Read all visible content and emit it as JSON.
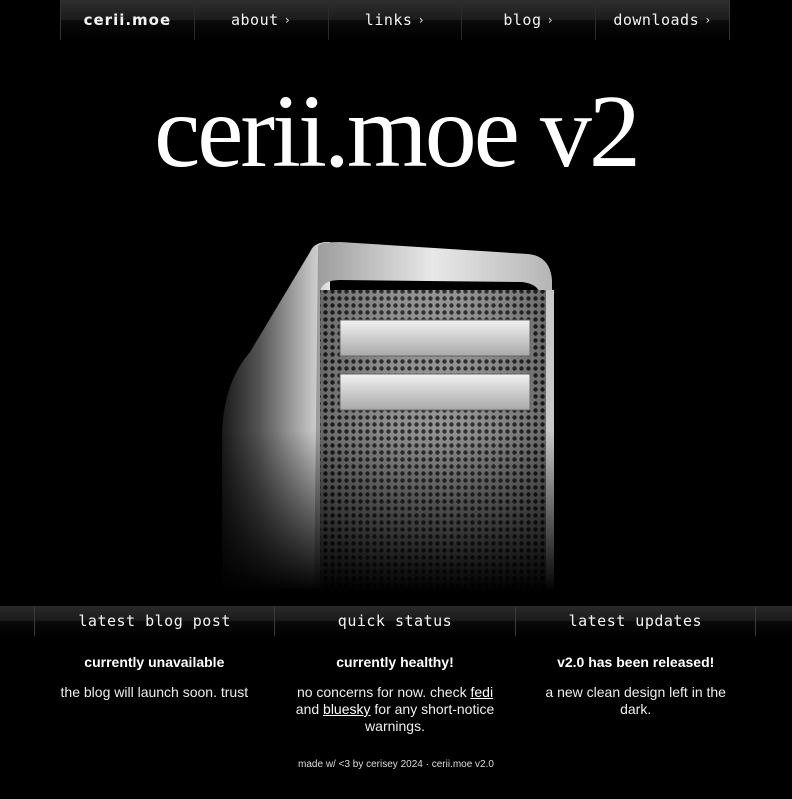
{
  "nav": {
    "brand": "cerii.moe",
    "items": [
      {
        "label": "about",
        "icon": "chevron-right-icon"
      },
      {
        "label": "links",
        "icon": "chevron-right-icon"
      },
      {
        "label": "blog",
        "icon": "chevron-right-icon"
      },
      {
        "label": "downloads",
        "icon": "chevron-right-icon"
      }
    ]
  },
  "hero": {
    "title": "cerii.moe v2",
    "image": "computer-tower-image"
  },
  "sections": {
    "headers": [
      "latest blog post",
      "quick status",
      "latest updates"
    ],
    "blog": {
      "heading": "currently unavailable",
      "body": "the blog will launch soon. trust"
    },
    "status": {
      "heading": "currently healthy!",
      "body_prefix": "no concerns for now. check",
      "link1": "fedi",
      "middle": "and",
      "link2": "bluesky",
      "body_suffix": "for any short-notice warnings."
    },
    "updates": {
      "heading": "v2.0 has been released!",
      "body": "a new clean design left in the dark."
    }
  },
  "footer": {
    "text": "made w/ <3 by cerisey 2024 · cerii.moe v2.0"
  },
  "colors": {
    "background": "#000000",
    "text": "#ffffff"
  }
}
